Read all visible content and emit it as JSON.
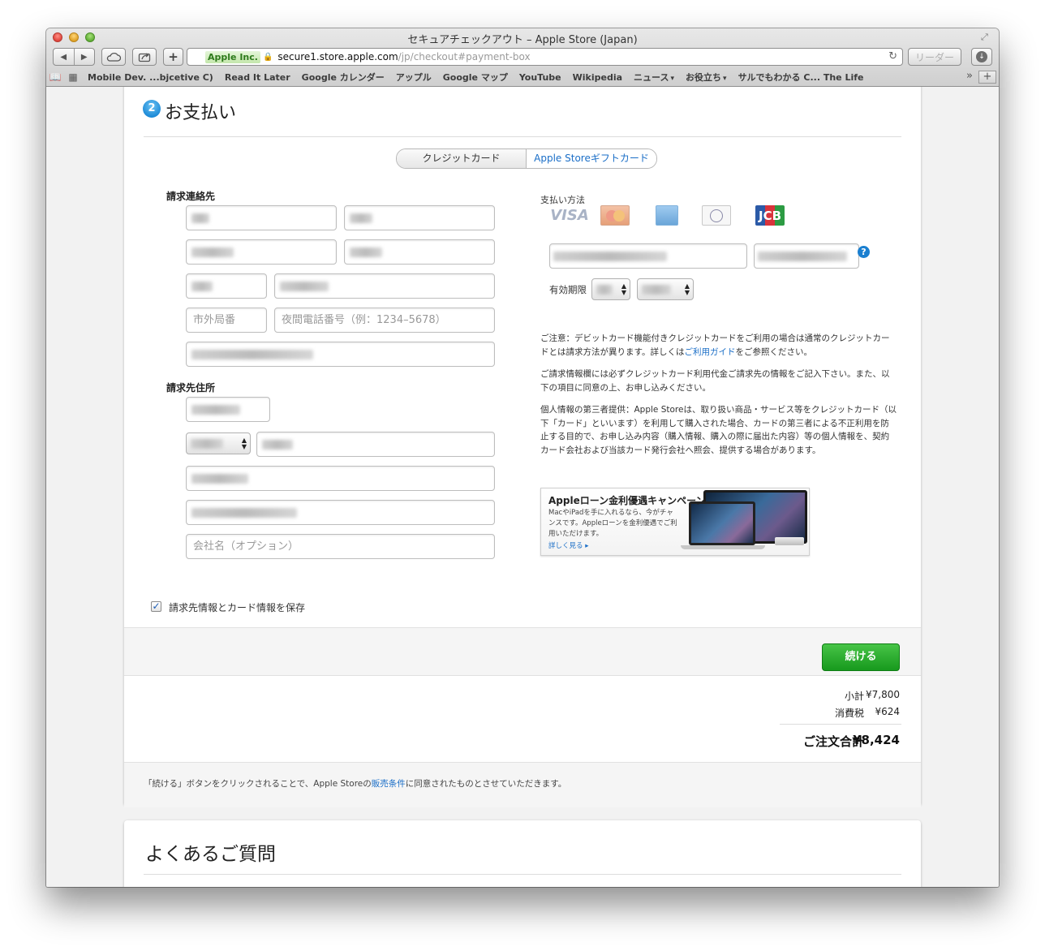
{
  "window": {
    "title": "セキュアチェックアウト – Apple Store (Japan)",
    "reader_label": "リーダー",
    "ev_name": "Apple Inc.",
    "url_host": "secure1.store.apple.com",
    "url_path": "/jp/checkout#payment-box"
  },
  "bookmarks": [
    {
      "label": "Mobile Dev. ...bjcetive C)"
    },
    {
      "label": "Read It Later"
    },
    {
      "label": "Google カレンダー"
    },
    {
      "label": "アップル"
    },
    {
      "label": "Google マップ"
    },
    {
      "label": "YouTube"
    },
    {
      "label": "Wikipedia"
    },
    {
      "label": "ニュース"
    },
    {
      "label": "お役立ち"
    },
    {
      "label": "サルでもわかる C... The Life"
    }
  ],
  "payment": {
    "step_number": "2",
    "title": "お支払い",
    "tabs": {
      "credit_card": "クレジットカード",
      "gift_card": "Apple Storeギフトカード"
    },
    "billing_contact_label": "請求連絡先",
    "billing_address_label": "請求先住所",
    "placeholders": {
      "area_code": "市外局番",
      "night_phone": "夜間電話番号（例：1234–5678）",
      "company": "会社名（オプション）"
    },
    "payment_method_label": "支払い方法",
    "expiry_label": "有効期限",
    "note1_pre": "ご注意：デビットカード機能付きクレジットカードをご利用の場合は通常のクレジットカードとは請求方法が異ります。詳しくは",
    "note1_link": "ご利用ガイド",
    "note1_post": "をご参照ください。",
    "note2": "ご請求情報欄には必ずクレジットカード利用代金ご請求先の情報をご記入下さい。また、以下の項目に同意の上、お申し込みください。",
    "note3": "個人情報の第三者提供：Apple Storeは、取り扱い商品・サービス等をクレジットカード（以下「カード」といいます）を利用して購入された場合、カードの第三者による不正利用を防止する目的で、お申し込み内容（購入情報、購入の際に届出た内容）等の個人情報を、契約カード会社および当該カード発行会社へ照会、提供する場合があります。",
    "promo": {
      "title": "Appleローン金利優遇キャンペーン",
      "body": "MacやiPadを手に入れるなら、今がチャンスです。Appleローンを金利優遇でご利用いただけます。",
      "link": "詳しく見る ▸"
    },
    "save_label": "請求先情報とカード情報を保存",
    "save_checked": true,
    "continue_label": "続ける",
    "summary": {
      "subtotal_label": "小計",
      "subtotal": "¥7,800",
      "tax_label": "消費税",
      "tax": "¥624",
      "total_label": "ご注文合計",
      "total": "¥8,424"
    },
    "terms_pre": "「続ける」ボタンをクリックされることで、Apple Storeの",
    "terms_link": "販売条件",
    "terms_post": "に同意されたものとさせていただきます。"
  },
  "faq": {
    "title": "よくあるご質問"
  },
  "icons": [
    "back-icon",
    "forward-icon",
    "icloud-icon",
    "share-icon",
    "add-icon",
    "lock-icon",
    "reload-icon",
    "downloads-icon",
    "reading-list-icon",
    "top-sites-icon",
    "help-icon",
    "checkmark-icon"
  ]
}
